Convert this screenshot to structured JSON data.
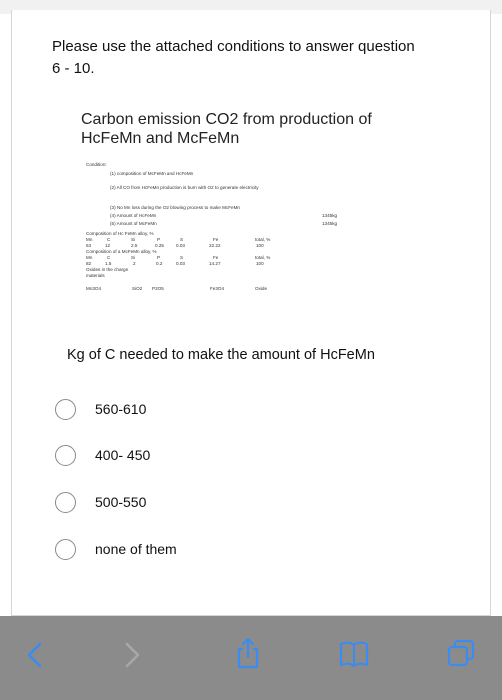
{
  "intro": {
    "line1": "Please use the attached  conditions to answer question",
    "line2": "6 - 10."
  },
  "attachment": {
    "title_line1": "Carbon emission CO2 from production of",
    "title_line2": "HcFeMn and McFeMn",
    "condition_heading": "Condition:",
    "conditions": [
      "(1) composition of McFeMn and HcFeMn",
      "(2) All CO from HcFeMn production is burn with O2 to generate electricity",
      "(3) No Mn loss during the O2 blowing process to make McFeMn",
      "(4) Amount of HcFeMn",
      "(5) Amount of McFeMn"
    ],
    "amounts": [
      "1345kg",
      "1345kg"
    ],
    "hc_heading": "Composition of Hc FeMn alloy, %",
    "hc_header": [
      "Mn",
      "C",
      "Si",
      "P",
      "S",
      "Fe",
      "total, %"
    ],
    "hc_values": [
      "63",
      "12",
      "2.5",
      "0.25",
      "0.03",
      "22.22",
      "100"
    ],
    "mc_heading": "Composition of a McFeMn alloy, %",
    "mc_header": [
      "Mn",
      "C",
      "Si",
      "P",
      "S",
      "Fe",
      "total, %"
    ],
    "mc_values": [
      "82",
      "1.5",
      "2",
      "0.2",
      "0.03",
      "14.27",
      "100"
    ],
    "oxides_line1": "Oxides in the charge",
    "oxides_line2": "materials",
    "oxides": [
      "Mn3O4",
      "SiO2",
      "P2O5",
      "Fe3O4",
      "Oxide"
    ]
  },
  "question": {
    "text": "Kg of C needed to make the amount of HcFeMn",
    "options": [
      "560-610",
      "400- 450",
      "500-550",
      "none of them"
    ]
  },
  "toolbar": {
    "icons": [
      "back-icon",
      "forward-icon",
      "share-icon",
      "bookmarks-icon",
      "tabs-icon"
    ]
  }
}
